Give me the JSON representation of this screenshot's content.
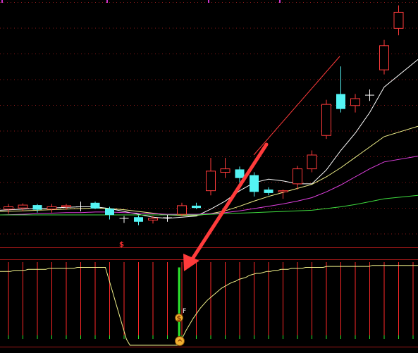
{
  "colors": {
    "background": "#000000",
    "grid": "#8b1a1a",
    "separator": "#a01818",
    "candle_up": "#ff3b3b",
    "candle_down": "#54f4f4",
    "doji": "#ffffff",
    "ma5": "#ffffff",
    "ma10": "#f2f28a",
    "ma20": "#e040e0",
    "ma60": "#3fdc3f",
    "indicator_line": "#f2f28a",
    "bar_red": "#ff2828",
    "bar_green": "#2ee82e",
    "arrow": "#ff3b3b",
    "marker_fill": "#f0b030"
  },
  "chart_data": [
    {
      "type": "candlestick",
      "candles": [
        {
          "o": 9.96,
          "h": 10.05,
          "l": 9.88,
          "c": 10.0
        },
        {
          "o": 9.98,
          "h": 10.06,
          "l": 9.92,
          "c": 10.03
        },
        {
          "o": 10.03,
          "h": 10.05,
          "l": 9.9,
          "c": 9.95
        },
        {
          "o": 9.96,
          "h": 10.05,
          "l": 9.9,
          "c": 10.0
        },
        {
          "o": 10.0,
          "h": 10.05,
          "l": 9.95,
          "c": 10.02
        },
        {
          "o": 10.0,
          "h": 10.09,
          "l": 9.92,
          "c": 10.0
        },
        {
          "o": 10.07,
          "h": 10.09,
          "l": 9.96,
          "c": 9.97
        },
        {
          "o": 9.97,
          "h": 10.0,
          "l": 9.78,
          "c": 9.86
        },
        {
          "o": 9.8,
          "h": 9.84,
          "l": 9.72,
          "c": 9.8
        },
        {
          "o": 9.82,
          "h": 9.85,
          "l": 9.68,
          "c": 9.74
        },
        {
          "o": 9.77,
          "h": 9.84,
          "l": 9.71,
          "c": 9.8
        },
        {
          "o": 9.8,
          "h": 9.86,
          "l": 9.74,
          "c": 9.81
        },
        {
          "o": 9.87,
          "h": 10.07,
          "l": 9.84,
          "c": 10.02
        },
        {
          "o": 10.02,
          "h": 10.07,
          "l": 9.96,
          "c": 9.98
        },
        {
          "o": 10.28,
          "h": 10.85,
          "l": 10.2,
          "c": 10.62
        },
        {
          "o": 10.6,
          "h": 10.85,
          "l": 10.5,
          "c": 10.66
        },
        {
          "o": 10.65,
          "h": 10.7,
          "l": 10.42,
          "c": 10.5
        },
        {
          "o": 10.55,
          "h": 10.6,
          "l": 10.18,
          "c": 10.26
        },
        {
          "o": 10.3,
          "h": 10.34,
          "l": 10.2,
          "c": 10.24
        },
        {
          "o": 10.26,
          "h": 10.3,
          "l": 10.14,
          "c": 10.28
        },
        {
          "o": 10.4,
          "h": 10.71,
          "l": 10.3,
          "c": 10.66
        },
        {
          "o": 10.66,
          "h": 10.98,
          "l": 10.6,
          "c": 10.9
        },
        {
          "o": 11.24,
          "h": 11.86,
          "l": 11.18,
          "c": 11.78
        },
        {
          "o": 11.96,
          "h": 12.44,
          "l": 11.64,
          "c": 11.7
        },
        {
          "o": 11.76,
          "h": 11.96,
          "l": 11.64,
          "c": 11.88
        },
        {
          "o": 11.94,
          "h": 12.04,
          "l": 11.84,
          "c": 11.94
        },
        {
          "o": 12.38,
          "h": 12.9,
          "l": 12.3,
          "c": 12.8
        },
        {
          "o": 13.1,
          "h": 13.5,
          "l": 12.98,
          "c": 13.38
        }
      ],
      "moving_averages": [
        {
          "values": [
            9.94,
            9.96,
            9.97,
            9.98,
            9.99,
            10.0,
            10.0,
            9.97,
            9.92,
            9.87,
            9.82,
            9.8,
            9.82,
            9.84,
            9.96,
            10.1,
            10.28,
            10.42,
            10.48,
            10.45,
            10.4,
            10.4,
            10.64,
            10.98,
            11.28,
            11.64,
            12.08,
            12.56
          ]
        },
        {
          "values": [
            9.92,
            9.93,
            9.94,
            9.95,
            9.96,
            9.97,
            9.98,
            9.97,
            9.95,
            9.92,
            9.89,
            9.86,
            9.85,
            9.85,
            9.88,
            9.93,
            10.01,
            10.1,
            10.18,
            10.25,
            10.32,
            10.39,
            10.52,
            10.68,
            10.86,
            11.04,
            11.22,
            11.4
          ]
        },
        {
          "values": [
            9.86,
            9.87,
            9.88,
            9.89,
            9.9,
            9.9,
            9.91,
            9.91,
            9.9,
            9.89,
            9.88,
            9.87,
            9.87,
            9.87,
            9.88,
            9.9,
            9.93,
            9.97,
            10.01,
            10.05,
            10.1,
            10.16,
            10.26,
            10.38,
            10.52,
            10.66,
            10.78,
            10.88
          ]
        },
        {
          "values": [
            9.86,
            9.86,
            9.86,
            9.86,
            9.86,
            9.86,
            9.86,
            9.86,
            9.86,
            9.86,
            9.86,
            9.86,
            9.86,
            9.86,
            9.87,
            9.88,
            9.89,
            9.9,
            9.91,
            9.92,
            9.93,
            9.94,
            9.97,
            10.0,
            10.04,
            10.09,
            10.14,
            10.2
          ]
        }
      ],
      "ylim": [
        9.48,
        13.52
      ],
      "grid": true,
      "title": "",
      "xlabel": "",
      "ylabel": ""
    },
    {
      "type": "line",
      "x": [
        0,
        1,
        2,
        3,
        4,
        5,
        6,
        7,
        8,
        9,
        10,
        11,
        12,
        13,
        14,
        15,
        16,
        17,
        18,
        19,
        20,
        21,
        22,
        23,
        24,
        25,
        26,
        27,
        28,
        29,
        30,
        31,
        32,
        33,
        34,
        35,
        36,
        37,
        38,
        39,
        40,
        41,
        42,
        43,
        44,
        45,
        46,
        47,
        48,
        49,
        50,
        51,
        52,
        53,
        54,
        55,
        56,
        57,
        58,
        59,
        60,
        61,
        62,
        63,
        64,
        65,
        66,
        67,
        68,
        69,
        70,
        71,
        72,
        73,
        74,
        75,
        76,
        77,
        78,
        79,
        80,
        81,
        82,
        83,
        84,
        85,
        86,
        87,
        88,
        89,
        90,
        91,
        92,
        93,
        94,
        95,
        96,
        97,
        98,
        99,
        100,
        101,
        102,
        103,
        104,
        105,
        106,
        107,
        108,
        109,
        110,
        111,
        112,
        113,
        114,
        115,
        116,
        117,
        118,
        119
      ],
      "series": [
        {
          "values": [
            74,
            74,
            74,
            74,
            75,
            75,
            75,
            75,
            76,
            76,
            76,
            76,
            76,
            76,
            77,
            77,
            77,
            77,
            77,
            77,
            77,
            77,
            78,
            78,
            78,
            78,
            78,
            78,
            78,
            78,
            78,
            66,
            54,
            42,
            30,
            18,
            6,
            0,
            0,
            0,
            0,
            0,
            0,
            0,
            0,
            0,
            0,
            0,
            0,
            0,
            0,
            0,
            8,
            15,
            21,
            27,
            32,
            37,
            41,
            45,
            48,
            51,
            54,
            57,
            59,
            61,
            63,
            64,
            66,
            67,
            68,
            70,
            71,
            72,
            72,
            73,
            74,
            74,
            75,
            75,
            76,
            76,
            76,
            77,
            77,
            77,
            77,
            78,
            78,
            78,
            78,
            78,
            78,
            79,
            79,
            79,
            79,
            79,
            79,
            79,
            79,
            79,
            79,
            79,
            79,
            79,
            80,
            80,
            80,
            80,
            80,
            80,
            80,
            80,
            80,
            80,
            80,
            80,
            80,
            80
          ]
        },
        {
          "values": [
            0,
            0,
            0,
            0,
            0,
            0,
            0,
            0,
            0,
            0,
            0,
            0,
            0,
            0,
            0,
            0,
            0,
            0,
            0,
            0,
            0,
            0,
            0,
            0,
            0,
            0,
            0,
            0,
            0,
            0,
            0,
            0,
            0,
            0,
            0,
            0,
            0,
            0,
            0,
            0,
            0,
            0,
            0,
            0,
            0,
            0,
            0,
            0,
            0,
            0,
            0,
            78,
            0,
            0,
            0,
            0,
            0,
            0,
            0,
            0,
            0,
            0,
            0,
            0,
            0,
            0,
            0,
            0,
            0,
            0,
            0,
            0,
            0,
            0,
            0,
            0,
            0,
            0,
            0,
            0,
            0,
            0,
            0,
            0,
            0,
            0,
            0,
            0,
            0,
            0,
            0,
            0,
            0,
            0,
            0,
            0,
            0,
            0,
            0,
            0,
            0,
            0,
            0,
            0,
            0,
            0,
            0,
            0,
            0,
            0,
            0,
            0,
            0,
            0,
            0,
            0,
            0,
            0,
            0,
            0
          ]
        }
      ],
      "ylim": [
        0,
        84
      ],
      "grid": true,
      "title": "",
      "xlabel": "",
      "ylabel": ""
    }
  ],
  "annotations": {
    "upper_marker_symbol": "$",
    "lower_marker_symbol": "$",
    "lower_marker_suffix": "F",
    "bottom_marker_symbol": "^"
  }
}
